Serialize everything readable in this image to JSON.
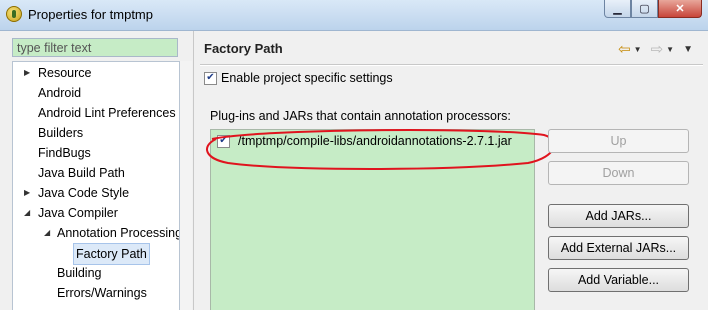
{
  "window": {
    "title": "Properties for tmptmp",
    "minimize_glyph": "▁",
    "maximize_glyph": "▢",
    "close_glyph": "✕"
  },
  "filter": {
    "placeholder": "type filter text"
  },
  "tree": {
    "items": [
      {
        "label": "Resource",
        "expand": "▶"
      },
      {
        "label": "Android"
      },
      {
        "label": "Android Lint Preferences"
      },
      {
        "label": "Builders"
      },
      {
        "label": "FindBugs"
      },
      {
        "label": "Java Build Path"
      },
      {
        "label": "Java Code Style",
        "expand": "▶"
      },
      {
        "label": "Java Compiler",
        "expand": "◢"
      },
      {
        "label": "Annotation Processing",
        "expand": "◢"
      },
      {
        "label": "Factory Path",
        "selected": true
      },
      {
        "label": "Building"
      },
      {
        "label": "Errors/Warnings"
      }
    ]
  },
  "page": {
    "title": "Factory Path",
    "enable_label": "Enable project specific settings",
    "enable_checked": true,
    "list_label": "Plug-ins and JARs that contain annotation processors:",
    "entries": [
      {
        "path": "/tmptmp/compile-libs/androidannotations-2.7.1.jar",
        "checked": true
      }
    ],
    "buttons": {
      "up": "Up",
      "down": "Down",
      "add_jars": "Add JARs...",
      "add_external_jars": "Add External JARs...",
      "add_variable": "Add Variable..."
    }
  },
  "colors": {
    "highlight_green": "#c6ecc6",
    "annotation_red": "#e0141e"
  }
}
